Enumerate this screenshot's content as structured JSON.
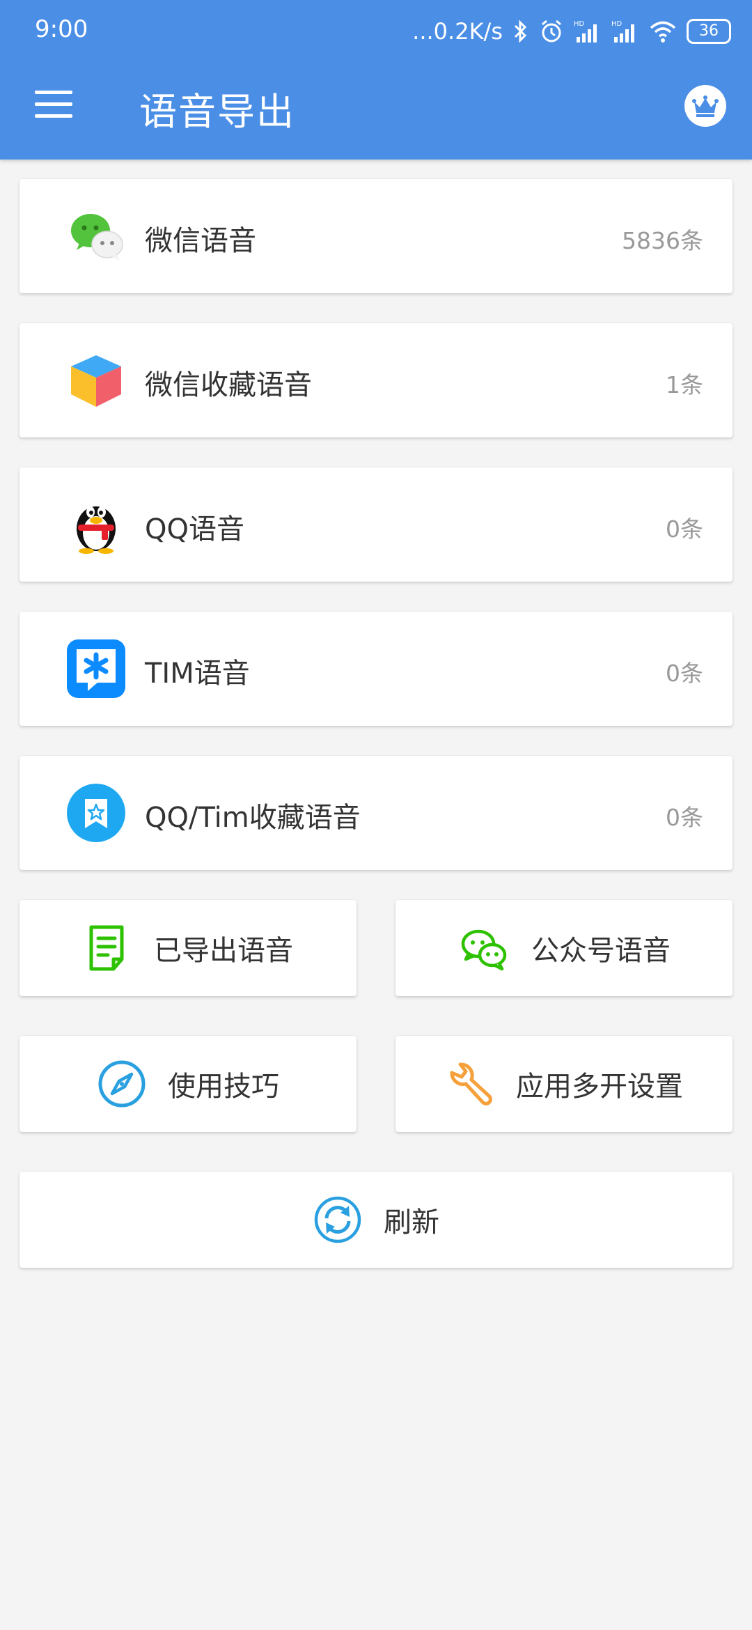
{
  "status_bar": {
    "time": "9:00",
    "net_speed": "...0.2K/s",
    "battery": "36"
  },
  "appbar": {
    "title": "语音导出",
    "menu_icon": "menu-icon",
    "crown_icon": "crown-icon"
  },
  "sources": [
    {
      "label": "微信语音",
      "count": "5836条",
      "icon": "wechat-icon"
    },
    {
      "label": "微信收藏语音",
      "count": "1条",
      "icon": "cube-icon"
    },
    {
      "label": "QQ语音",
      "count": "0条",
      "icon": "qq-penguin-icon"
    },
    {
      "label": "TIM语音",
      "count": "0条",
      "icon": "tim-icon"
    },
    {
      "label": "QQ/Tim收藏语音",
      "count": "0条",
      "icon": "star-bookmark-icon"
    }
  ],
  "actions": {
    "exported": {
      "label": "已导出语音",
      "icon": "document-icon"
    },
    "official": {
      "label": "公众号语音",
      "icon": "wechat-outline-icon"
    },
    "tips": {
      "label": "使用技巧",
      "icon": "compass-icon"
    },
    "multi_open": {
      "label": "应用多开设置",
      "icon": "wrench-icon"
    },
    "refresh": {
      "label": "刷新",
      "icon": "refresh-icon"
    }
  },
  "colors": {
    "appbar": "#4a8ee6",
    "background": "#f4f4f4",
    "wechat_green": "#2dc100",
    "tim_blue": "#0c8bff",
    "qq_fav_blue": "#1fa8f2",
    "compass_blue": "#2aa0e0",
    "wrench_orange": "#f5a03a"
  }
}
